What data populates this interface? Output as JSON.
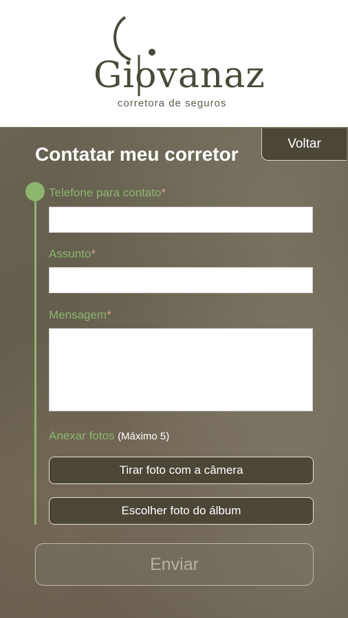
{
  "brand": {
    "name": "Giovanaz",
    "tagline": "corretora de seguros"
  },
  "page": {
    "title": "Contatar meu corretor",
    "back_label": "Voltar"
  },
  "form": {
    "phone_label": "Telefone para contato",
    "subject_label": "Assunto",
    "message_label": "Mensagem",
    "required_mark": "*",
    "phone_value": "",
    "subject_value": "",
    "message_value": "",
    "attach_label": "Anexar fotos",
    "attach_note": "(Máximo 5)",
    "camera_button": "Tirar foto com a câmera",
    "album_button": "Escolher foto do álbum",
    "submit_button": "Enviar"
  },
  "colors": {
    "accent_green": "#8cb56e",
    "required_red": "#d9a38f",
    "button_bg": "#4b4636"
  }
}
